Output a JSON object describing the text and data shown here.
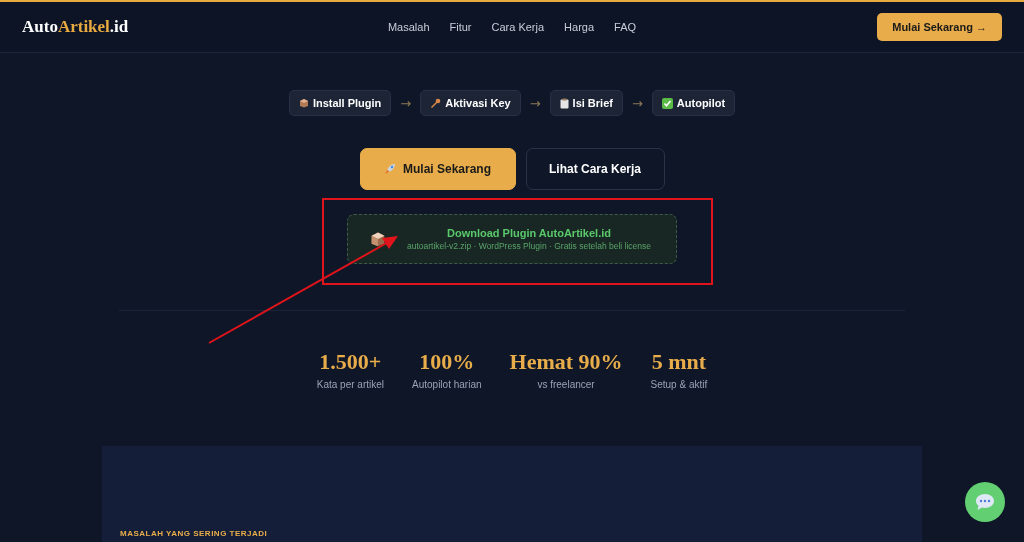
{
  "header": {
    "logo": {
      "first": "Auto",
      "accent": "Artikel",
      "last": ".id"
    },
    "nav": [
      "Masalah",
      "Fitur",
      "Cara Kerja",
      "Harga",
      "FAQ"
    ],
    "cta": "Mulai Sekarang →"
  },
  "steps": [
    {
      "kind": "box",
      "label": "Install Plugin"
    },
    {
      "kind": "key",
      "label": "Aktivasi Key"
    },
    {
      "kind": "clipboard",
      "label": "Isi Brief"
    },
    {
      "kind": "check",
      "label": "Autopilot"
    }
  ],
  "step_arrow": "→",
  "buttons": [
    {
      "kind": "primary",
      "label": "Mulai Sekarang"
    },
    {
      "kind": "secondary",
      "label": "Lihat Cara Kerja"
    }
  ],
  "download": {
    "title": "Download Plugin AutoArtikel.id",
    "subtitle": "autoartikel-v2.zip · WordPress Plugin · Gratis setelah beli license"
  },
  "stats": [
    {
      "value": "1.500+",
      "label": "Kata per artikel"
    },
    {
      "value": "100%",
      "label": "Autopilot harian"
    },
    {
      "value": "Hemat 90%",
      "label": "vs freelancer"
    },
    {
      "value": "5 mnt",
      "label": "Setup & aktif"
    }
  ],
  "section": {
    "eyebrow": "MASALAH YANG SERING TERJADI"
  }
}
